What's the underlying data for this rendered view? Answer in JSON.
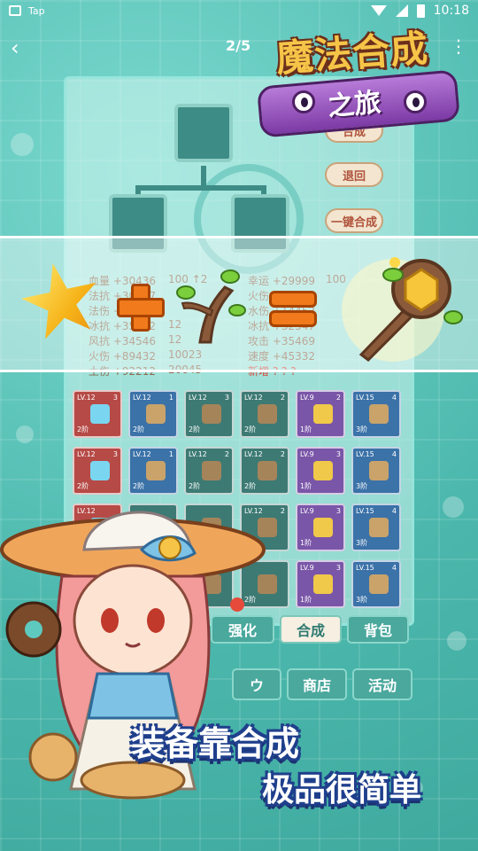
{
  "status_bar": {
    "carrier": "Tap",
    "time": "10:18"
  },
  "nav": {
    "page_counter": "2/5"
  },
  "logo": {
    "title_top": "魔法合成",
    "title_bottom": "之旅"
  },
  "panel": {
    "side_buttons": [
      "合成",
      "退回",
      "一键合成"
    ],
    "stats": [
      [
        "血量 +30436",
        "100 ↑2",
        "幸运 +29999",
        "100"
      ],
      [
        "法抗 +30437",
        "",
        "火伤 +51311",
        ""
      ],
      [
        "法伤 +32147",
        "",
        "水伤 +14452",
        ""
      ],
      [
        "冰抗 +35452",
        "12",
        "冰抗 +32547",
        ""
      ],
      [
        "风抗 +34546",
        "12",
        "攻击 +35469",
        ""
      ],
      [
        "火伤 +89432",
        "10023",
        "速度 +45332",
        ""
      ],
      [
        "土伤 +92212",
        "20045",
        "新增 ? ? ?",
        ""
      ]
    ]
  },
  "grid": {
    "rows": [
      [
        {
          "lv": "LV.12",
          "count": "3",
          "tier": "2阶",
          "theme": "red"
        },
        {
          "lv": "LV.12",
          "count": "1",
          "tier": "2阶",
          "theme": "blue"
        },
        {
          "lv": "LV.12",
          "count": "3",
          "tier": "2阶",
          "theme": "teal"
        },
        {
          "lv": "LV.12",
          "count": "2",
          "tier": "2阶",
          "theme": "teal"
        },
        {
          "lv": "LV.9",
          "count": "2",
          "tier": "1阶",
          "theme": "purple"
        },
        {
          "lv": "LV.15",
          "count": "4",
          "tier": "3阶",
          "theme": "blue"
        }
      ],
      [
        {
          "lv": "LV.12",
          "count": "3",
          "tier": "2阶",
          "theme": "red"
        },
        {
          "lv": "LV.12",
          "count": "1",
          "tier": "2阶",
          "theme": "blue"
        },
        {
          "lv": "LV.12",
          "count": "2",
          "tier": "2阶",
          "theme": "teal"
        },
        {
          "lv": "LV.12",
          "count": "2",
          "tier": "2阶",
          "theme": "teal"
        },
        {
          "lv": "LV.9",
          "count": "3",
          "tier": "1阶",
          "theme": "purple"
        },
        {
          "lv": "LV.15",
          "count": "4",
          "tier": "3阶",
          "theme": "blue"
        }
      ],
      [
        {
          "lv": "LV.12",
          "count": "",
          "tier": "",
          "theme": "red"
        },
        {
          "lv": "",
          "count": "",
          "tier": "",
          "theme": "teal"
        },
        {
          "lv": "",
          "count": "",
          "tier": "",
          "theme": "teal"
        },
        {
          "lv": "LV.12",
          "count": "2",
          "tier": "2阶",
          "theme": "teal"
        },
        {
          "lv": "LV.9",
          "count": "3",
          "tier": "1阶",
          "theme": "purple"
        },
        {
          "lv": "LV.15",
          "count": "4",
          "tier": "3阶",
          "theme": "blue"
        }
      ],
      [
        {
          "lv": "",
          "count": "",
          "tier": "",
          "theme": "teal"
        },
        {
          "lv": "",
          "count": "",
          "tier": "",
          "theme": "teal"
        },
        {
          "lv": "",
          "count": "",
          "tier": "",
          "theme": "teal"
        },
        {
          "lv": "",
          "count": "",
          "tier": "2阶",
          "theme": "teal"
        },
        {
          "lv": "LV.9",
          "count": "3",
          "tier": "1阶",
          "theme": "purple"
        },
        {
          "lv": "LV.15",
          "count": "4",
          "tier": "3阶",
          "theme": "blue"
        }
      ]
    ]
  },
  "tabs": {
    "strengthen": "强化",
    "synthesize": "合成",
    "backpack": "背包",
    "shop_partial": "ウ",
    "shop": "商店",
    "activity": "活动"
  },
  "slogan": {
    "line1": "装备靠合成",
    "line2": "极品很简单"
  },
  "colors": {
    "background": "#5ec9bf",
    "accent_orange": "#f07a1c",
    "slogan_outline": "#1f3f8c",
    "logo_gold": "#f6c548"
  }
}
